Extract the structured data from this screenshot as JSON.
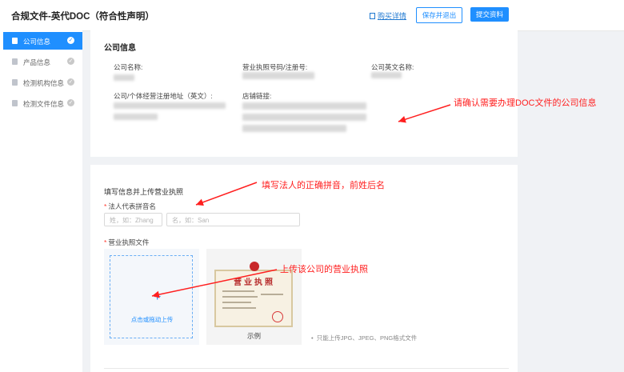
{
  "header": {
    "title": "合规文件-英代DOC（符合性声明）",
    "link": "购买详情",
    "save_button": "保存并退出",
    "submit_button": "提交资料"
  },
  "sidebar": {
    "items": [
      {
        "label": "公司信息",
        "active": true,
        "icon": "document-icon"
      },
      {
        "label": "产品信息",
        "active": false,
        "icon": "cube-icon"
      },
      {
        "label": "检测机构信息",
        "active": false,
        "icon": "document-icon"
      },
      {
        "label": "检测文件信息",
        "active": false,
        "icon": "document-icon"
      }
    ]
  },
  "company": {
    "section_title": "公司信息",
    "name_label": "公司名称:",
    "license_label": "营业执照号码/注册号:",
    "english_name_label": "公司英文名称:",
    "address_label": "公司/个体经营注册地址（英文）:",
    "shop_link_label": "店铺链接:"
  },
  "form": {
    "section_title": "填写信息并上传营业执照",
    "legal_rep_label": "法人代表拼音名",
    "surname_placeholder": "姓，如：Zhang",
    "given_placeholder": "名，如：San",
    "license_file_label": "营业执照文件",
    "upload_text": "点击或拖动上传",
    "example_label": "示例",
    "example_title": "营业执照",
    "note": "只能上传JPG、JPEG、PNG格式文件"
  },
  "annotations": {
    "confirm_company": "请确认需要办理DOC文件的公司信息",
    "fill_legal_name": "填写法人的正确拼音，前姓后名",
    "upload_license": "上传该公司的营业执照"
  },
  "colors": {
    "accent": "#1f8fff",
    "annotation": "#ff2020"
  }
}
